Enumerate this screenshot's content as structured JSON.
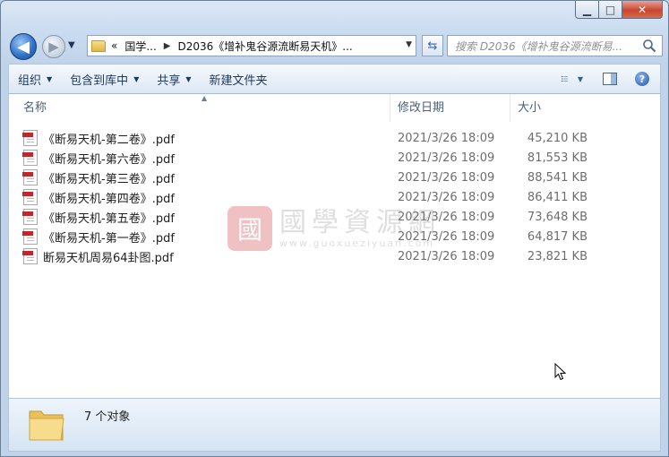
{
  "window": {
    "caption": {
      "minimize": "▁",
      "maximize": "□",
      "close": "✕"
    }
  },
  "nav": {
    "back_icon": "◀",
    "forward_icon": "▶",
    "crumbs": [
      "«",
      "国学...",
      "D2036《增补鬼谷源流断易天机》..."
    ],
    "search_placeholder": "搜索 D2036《增补鬼谷源流断易..."
  },
  "toolbar": {
    "organize": "组织",
    "include_library": "包含到库中",
    "share": "共享",
    "new_folder": "新建文件夹"
  },
  "columns": {
    "name": "名称",
    "date": "修改日期",
    "size": "大小"
  },
  "files": [
    {
      "name": "《断易天机-第二卷》.pdf",
      "date": "2021/3/26 18:09",
      "size": "45,210 KB"
    },
    {
      "name": "《断易天机-第六卷》.pdf",
      "date": "2021/3/26 18:09",
      "size": "81,553 KB"
    },
    {
      "name": "《断易天机-第三卷》.pdf",
      "date": "2021/3/26 18:09",
      "size": "88,541 KB"
    },
    {
      "name": "《断易天机-第四卷》.pdf",
      "date": "2021/3/26 18:09",
      "size": "86,411 KB"
    },
    {
      "name": "《断易天机-第五卷》.pdf",
      "date": "2021/3/26 18:09",
      "size": "73,648 KB"
    },
    {
      "name": "《断易天机-第一卷》.pdf",
      "date": "2021/3/26 18:09",
      "size": "64,817 KB"
    },
    {
      "name": "断易天机周易64卦图.pdf",
      "date": "2021/3/26 18:09",
      "size": "23,821 KB"
    }
  ],
  "watermark": {
    "seal": "國",
    "title": "國學資源網",
    "url": "www.guoxueziyuan.com"
  },
  "status": {
    "count": "7 个对象"
  }
}
